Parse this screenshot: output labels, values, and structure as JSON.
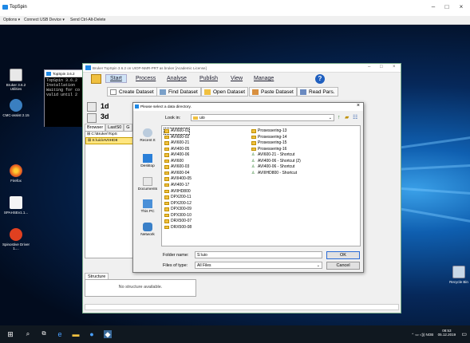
{
  "viewer": {
    "title": "TopSpin",
    "menu": {
      "options": "Options ▾",
      "connect_usb": "Connect USB Device ▾",
      "send_cad": "Send Ctrl-Alt-Delete"
    }
  },
  "desktop": {
    "icons": [
      {
        "label": "Bruker 3.6.2 Utilities",
        "color": "#d0d0d0"
      },
      {
        "label": "CMC-assist 2.15",
        "color": "#3a7fc0"
      },
      {
        "label": "Firefox",
        "color": "#e8601c"
      },
      {
        "label": "SPAHSEv1.1...",
        "color": "#f5f5f5"
      },
      {
        "label": "Spinostive Driver 1....",
        "color": "#e04020"
      },
      {
        "label": "Recycle Bin",
        "color": "#c8d8e8"
      }
    ]
  },
  "splash": {
    "title": "TopSpin 3.6.2",
    "terminal": "TopSpin 3.6.2\nInstallation\nWaiting for co\nvalid until 2"
  },
  "topspin": {
    "title": "Bruker TopSpin 3.6.2 on UIOP-NMR-PRT as bruker [Academic License]",
    "menu": [
      "Start",
      "Process",
      "Analyse",
      "Publish",
      "View",
      "Manage"
    ],
    "toolbar": {
      "create_dataset": "Create Dataset",
      "find_dataset": "Find Dataset",
      "open_dataset": "Open Dataset",
      "paste_dataset": "Paste Dataset",
      "read_pars": "Read Pars."
    },
    "nd": {
      "one_d": "1d",
      "three_d": "3d"
    },
    "browser_tabs": [
      "Browser",
      "LastS0",
      "G"
    ],
    "tree": [
      "C:\\Bruker\\TopS",
      "S:\\uio\\AVIIHD8"
    ],
    "structure_tab": "Structure",
    "structure_message": "No structure available."
  },
  "dialog": {
    "title": "Please select a data directory.",
    "look_in_label": "Look in:",
    "look_in_value": "uio",
    "places": [
      "Recent It",
      "Desktop",
      "Documents",
      "This PC",
      "Network"
    ],
    "files_col1": [
      "AVI600-01",
      "AVI600-02",
      "AVI600-21",
      "AVI400-05",
      "AVI400-06",
      "AVI600",
      "AVI600-03",
      "AVI600-04",
      "AVIII400-05",
      "AVI400-17",
      "AVIIHD800",
      "DPX200-11",
      "DPX200-12",
      "DPX300-09",
      "DPX300-10",
      "DRX500-07",
      "DRX500-08"
    ],
    "files_col2": [
      {
        "name": "Prosessering-13",
        "type": "folder"
      },
      {
        "name": "Prosessering-14",
        "type": "folder"
      },
      {
        "name": "Prosessering-15",
        "type": "folder"
      },
      {
        "name": "Prosessering-16",
        "type": "folder"
      },
      {
        "name": "AVI600-21 - Shortcut",
        "type": "shortcut"
      },
      {
        "name": "AVI400-06 - Shortcut (2)",
        "type": "shortcut"
      },
      {
        "name": "AVI400-06 - Shortcut",
        "type": "shortcut"
      },
      {
        "name": "AVIIIHD800 - Shortcut",
        "type": "shortcut"
      }
    ],
    "folder_name_label": "Folder name:",
    "folder_name_value": "S:\\uio",
    "files_of_type_label": "Files of type:",
    "files_of_type_value": "All Files",
    "ok": "OK",
    "cancel": "Cancel"
  },
  "taskbar": {
    "tray_lang": "NOB",
    "tray_time": "08:53",
    "tray_date": "05.12.2019"
  }
}
